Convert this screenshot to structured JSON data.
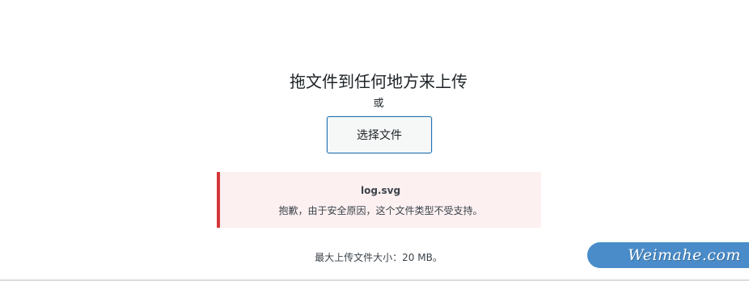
{
  "uploader": {
    "drop_title": "拖文件到任何地方来上传",
    "or_text": "或",
    "select_button_label": "选择文件",
    "max_size_text": "最大上传文件大小：20 MB。"
  },
  "error": {
    "filename": "log.svg",
    "message": "抱歉，由于安全原因，这个文件类型不受支持。"
  },
  "watermark": {
    "text": "Weimahe.com"
  },
  "colors": {
    "accent": "#2271b1",
    "error_border": "#d63638",
    "error_bg": "#fcf0f1",
    "watermark_bg": "#4a8cc9"
  }
}
